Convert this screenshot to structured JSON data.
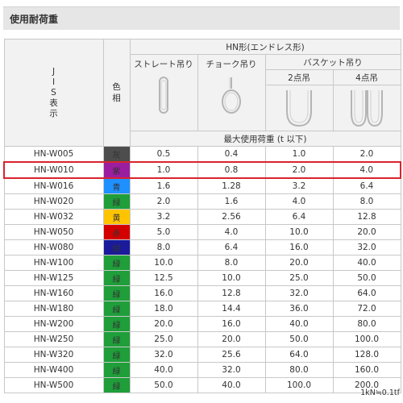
{
  "section_title": "使用耐荷重",
  "header": {
    "jis": [
      "J",
      "I",
      "S",
      "表",
      "示"
    ],
    "color": [
      "色",
      "相"
    ],
    "group": "HN形(エンドレス形)",
    "straight": "ストレート吊り",
    "choke": "チョーク吊り",
    "basket": "バスケット吊り",
    "two_point": "2点吊",
    "four_point": "4点吊",
    "max_load": "最大使用荷重 (t 以下)"
  },
  "rows": [
    {
      "model": "HN-W005",
      "color_name": "灰",
      "color": "#4d4d4d",
      "straight": "0.5",
      "choke": "0.4",
      "two": "1.0",
      "four": "2.0"
    },
    {
      "model": "HN-W010",
      "color_name": "紫",
      "color": "#9b1ea0",
      "straight": "1.0",
      "choke": "0.8",
      "two": "2.0",
      "four": "4.0"
    },
    {
      "model": "HN-W016",
      "color_name": "青",
      "color": "#1e90ff",
      "straight": "1.6",
      "choke": "1.28",
      "two": "3.2",
      "four": "6.4"
    },
    {
      "model": "HN-W020",
      "color_name": "緑",
      "color": "#1f9e3a",
      "straight": "2.0",
      "choke": "1.6",
      "two": "4.0",
      "four": "8.0"
    },
    {
      "model": "HN-W032",
      "color_name": "黄",
      "color": "#ffc400",
      "straight": "3.2",
      "choke": "2.56",
      "two": "6.4",
      "four": "12.8"
    },
    {
      "model": "HN-W050",
      "color_name": "赤",
      "color": "#d40000",
      "straight": "5.0",
      "choke": "4.0",
      "two": "10.0",
      "four": "20.0"
    },
    {
      "model": "HN-W080",
      "color_name": "紺",
      "color": "#1a1a9a",
      "straight": "8.0",
      "choke": "6.4",
      "two": "16.0",
      "four": "32.0"
    },
    {
      "model": "HN-W100",
      "color_name": "緑",
      "color": "#1f9e3a",
      "straight": "10.0",
      "choke": "8.0",
      "two": "20.0",
      "four": "40.0"
    },
    {
      "model": "HN-W125",
      "color_name": "緑",
      "color": "#1f9e3a",
      "straight": "12.5",
      "choke": "10.0",
      "two": "25.0",
      "four": "50.0"
    },
    {
      "model": "HN-W160",
      "color_name": "緑",
      "color": "#1f9e3a",
      "straight": "16.0",
      "choke": "12.8",
      "two": "32.0",
      "four": "64.0"
    },
    {
      "model": "HN-W180",
      "color_name": "緑",
      "color": "#1f9e3a",
      "straight": "18.0",
      "choke": "14.4",
      "two": "36.0",
      "four": "72.0"
    },
    {
      "model": "HN-W200",
      "color_name": "緑",
      "color": "#1f9e3a",
      "straight": "20.0",
      "choke": "16.0",
      "two": "40.0",
      "four": "80.0"
    },
    {
      "model": "HN-W250",
      "color_name": "緑",
      "color": "#1f9e3a",
      "straight": "25.0",
      "choke": "20.0",
      "two": "50.0",
      "four": "100.0"
    },
    {
      "model": "HN-W320",
      "color_name": "緑",
      "color": "#1f9e3a",
      "straight": "32.0",
      "choke": "25.6",
      "two": "64.0",
      "four": "128.0"
    },
    {
      "model": "HN-W400",
      "color_name": "緑",
      "color": "#1f9e3a",
      "straight": "40.0",
      "choke": "32.0",
      "two": "80.0",
      "four": "160.0"
    },
    {
      "model": "HN-W500",
      "color_name": "緑",
      "color": "#1f9e3a",
      "straight": "50.0",
      "choke": "40.0",
      "two": "100.0",
      "four": "200.0"
    }
  ],
  "highlight_row": 1,
  "highlight_color": "#d9242f",
  "footnote": "1kN≒0.1tf"
}
